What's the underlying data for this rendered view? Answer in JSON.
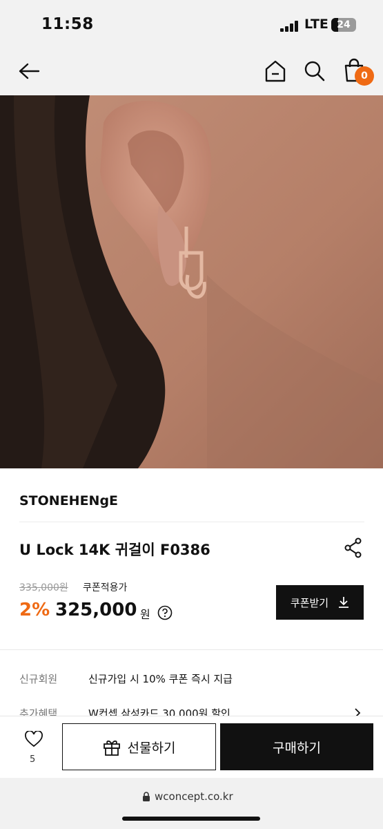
{
  "status_bar": {
    "time": "11:58",
    "network": "LTE",
    "battery": "24"
  },
  "header": {
    "cart_count": "0"
  },
  "product": {
    "brand": "STONEHENgE",
    "title": "U Lock 14K 귀걸이 F0386",
    "original_price": "335,000원",
    "coupon_note": "쿠폰적용가",
    "discount": "2%",
    "sale_price": "325,000",
    "currency": "원",
    "coupon_button_label": "쿠폰받기"
  },
  "benefits": [
    {
      "label": "신규회원",
      "value": "신규가입 시 10% 쿠폰 즉시 지급"
    },
    {
      "label": "추가혜택",
      "value": "W컨셉 삼성카드 30,000원 할인"
    }
  ],
  "bottom_bar": {
    "wish_count": "5",
    "gift_label": "선물하기",
    "buy_label": "구매하기"
  },
  "browser": {
    "url": "wconcept.co.kr"
  },
  "colors": {
    "accent": "#ef6a14",
    "dark": "#111111"
  }
}
